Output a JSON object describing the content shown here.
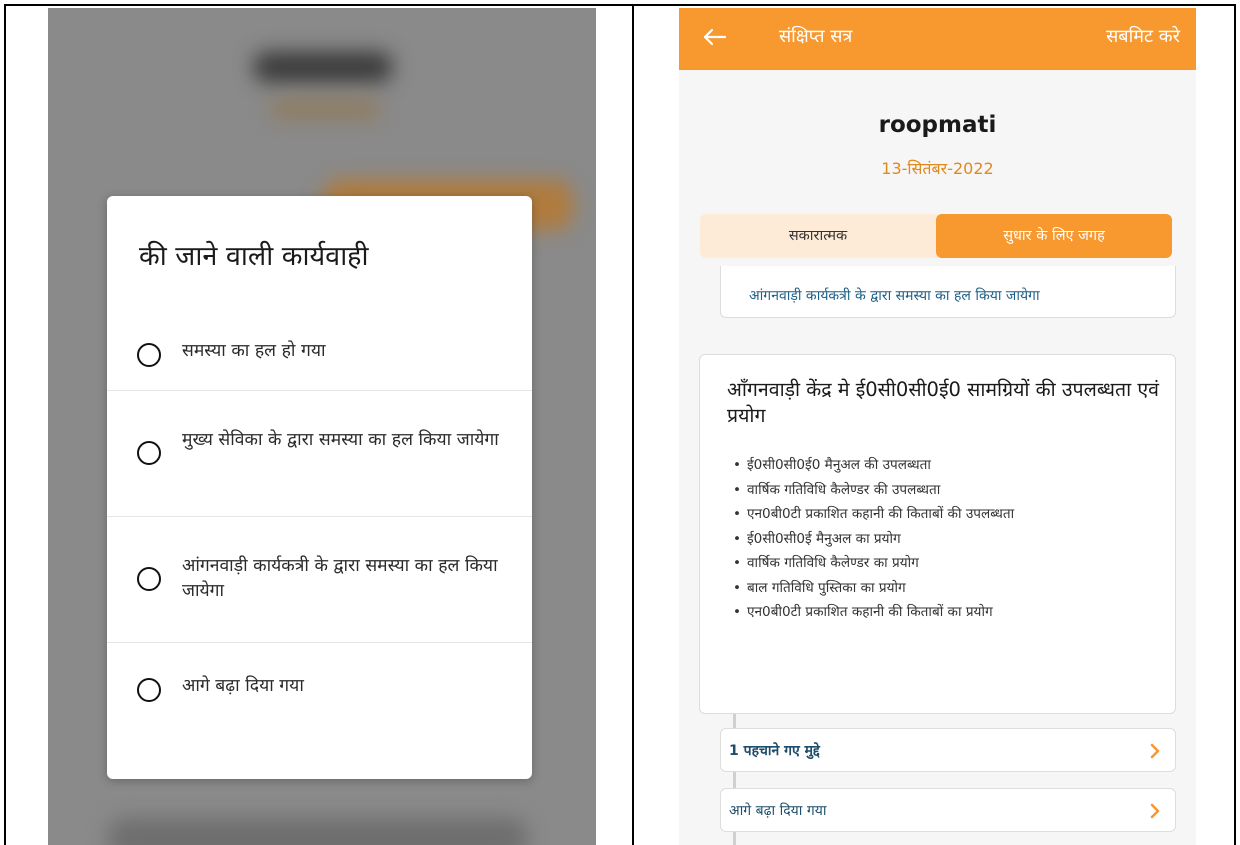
{
  "left_panel": {
    "dialog": {
      "title": "की जाने वाली कार्यवाही",
      "options": [
        {
          "label": "समस्या का हल हो गया",
          "selected": false
        },
        {
          "label": "मुख्य सेविका के द्वारा समस्या का हल किया जायेगा",
          "selected": false
        },
        {
          "label": "आंगनवाड़ी कार्यकत्री के द्वारा समस्या का हल किया जायेगा",
          "selected": false
        },
        {
          "label": "आगे बढ़ा दिया गया",
          "selected": false
        }
      ]
    }
  },
  "right_panel": {
    "header": {
      "back_icon": "arrow-left-icon",
      "title": "संक्षिप्त सत्र",
      "submit_label": "सबमिट करे"
    },
    "profile": {
      "name": "roopmati",
      "date": "13-सितंबर-2022"
    },
    "tabs": [
      {
        "label": "सकारात्मक",
        "active": false
      },
      {
        "label": "सुधार के लिए जगह",
        "active": true
      }
    ],
    "previous_card_text": "आंगनवाड़ी कार्यकत्री के द्वारा समस्या का हल किया जायेगा",
    "section": {
      "title": "आँगनवाड़ी केंद्र मे ई0सी0सी0ई0 सामग्रियों की उपलब्धता एवं प्रयोग",
      "items": [
        "ई0सी0सी0ई0 मैनुअल की उपलब्धता",
        "वार्षिक गतिविधि कैलेण्डर की उपलब्धता",
        "एन0बी0टी प्रकाशित कहानी की किताबों की उपलब्धता",
        "ई0सी0सी0ई मैनुअल का प्रयोग",
        "वार्षिक गतिविधि कैलेण्डर का प्रयोग",
        "बाल गतिविधि पुस्तिका का प्रयोग",
        "एन0बी0टी प्रकाशित कहानी की किताबों का प्रयोग"
      ]
    },
    "rows": [
      {
        "label": "1 पहचाने गए मुद्दे",
        "icon": "chevron-right-icon"
      },
      {
        "label": "आगे बढ़ा दिया गया",
        "icon": "chevron-right-icon"
      }
    ]
  },
  "colors": {
    "accent_orange": "#f7992f",
    "date_orange": "#e08a1e",
    "tab_bg": "#fdebd7",
    "link_blue": "#1d5f86",
    "dim_overlay": "#8a8a8a"
  }
}
